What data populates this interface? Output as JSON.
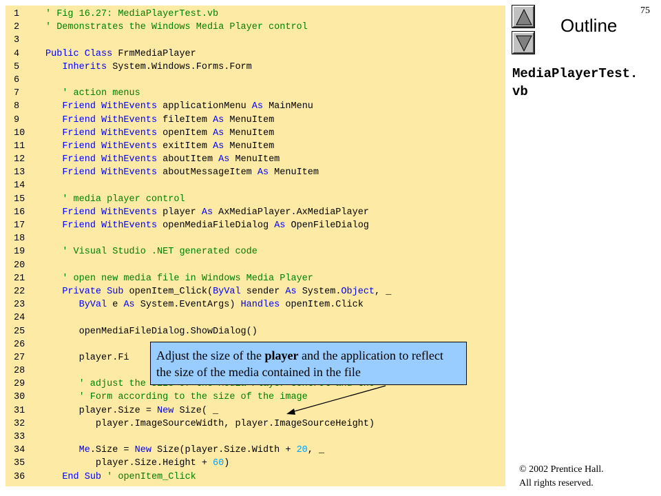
{
  "slide": {
    "page_number": "75",
    "outline_title": "Outline",
    "file_name_line1": "MediaPlayerTest.",
    "file_name_line2": "vb",
    "copyright_line1": "© 2002 Prentice Hall.",
    "copyright_line2": "All rights reserved."
  },
  "callout": {
    "text_before": "Adjust the size of the ",
    "bold_word": "player",
    "text_after": " and the application to reflect the size of the media contained in the file"
  },
  "code": {
    "lines": [
      {
        "n": "1",
        "t": "' Fig 16.27: MediaPlayerTest.vb"
      },
      {
        "n": "2",
        "t": "' Demonstrates the Windows Media Player control"
      },
      {
        "n": "3",
        "t": ""
      },
      {
        "n": "4",
        "t": "Public Class FrmMediaPlayer"
      },
      {
        "n": "5",
        "t": "   Inherits System.Windows.Forms.Form"
      },
      {
        "n": "6",
        "t": ""
      },
      {
        "n": "7",
        "t": "   ' action menus"
      },
      {
        "n": "8",
        "t": "   Friend WithEvents applicationMenu As MainMenu"
      },
      {
        "n": "9",
        "t": "   Friend WithEvents fileItem As MenuItem"
      },
      {
        "n": "10",
        "t": "   Friend WithEvents openItem As MenuItem"
      },
      {
        "n": "11",
        "t": "   Friend WithEvents exitItem As MenuItem"
      },
      {
        "n": "12",
        "t": "   Friend WithEvents aboutItem As MenuItem"
      },
      {
        "n": "13",
        "t": "   Friend WithEvents aboutMessageItem As MenuItem"
      },
      {
        "n": "14",
        "t": ""
      },
      {
        "n": "15",
        "t": "   ' media player control"
      },
      {
        "n": "16",
        "t": "   Friend WithEvents player As AxMediaPlayer.AxMediaPlayer"
      },
      {
        "n": "17",
        "t": "   Friend WithEvents openMediaFileDialog As OpenFileDialog"
      },
      {
        "n": "18",
        "t": ""
      },
      {
        "n": "19",
        "t": "   ' Visual Studio .NET generated code"
      },
      {
        "n": "20",
        "t": ""
      },
      {
        "n": "21",
        "t": "   ' open new media file in Windows Media Player"
      },
      {
        "n": "22",
        "t": "   Private Sub openItem_Click(ByVal sender As System.Object, _"
      },
      {
        "n": "23",
        "t": "      ByVal e As System.EventArgs) Handles openItem.Click"
      },
      {
        "n": "24",
        "t": ""
      },
      {
        "n": "25",
        "t": "      openMediaFileDialog.ShowDialog()"
      },
      {
        "n": "26",
        "t": ""
      },
      {
        "n": "27",
        "t": "      player.Fi"
      },
      {
        "n": "28",
        "t": ""
      },
      {
        "n": "29",
        "t": "      ' adjust the size of the Media Player control and the"
      },
      {
        "n": "30",
        "t": "      ' Form according to the size of the image"
      },
      {
        "n": "31",
        "t": "      player.Size = New Size( _"
      },
      {
        "n": "32",
        "t": "         player.ImageSourceWidth, player.ImageSourceHeight)"
      },
      {
        "n": "33",
        "t": ""
      },
      {
        "n": "34",
        "t": "      Me.Size = New Size(player.Size.Width + 20, _"
      },
      {
        "n": "35",
        "t": "         player.Size.Height + 60)"
      },
      {
        "n": "36",
        "t": "   End Sub ' openItem_Click"
      }
    ],
    "keywords": [
      "Public",
      "Class",
      "Inherits",
      "Friend",
      "WithEvents",
      "As",
      "Private",
      "Sub",
      "ByVal",
      "Handles",
      "New",
      "Me",
      "End",
      "Object"
    ],
    "colors": {
      "keyword": "#0000ff",
      "comment": "#008000",
      "number": "#00a0ff",
      "background": "#fdeaa4"
    }
  },
  "icons": {
    "up": "triangle-up-icon",
    "down": "triangle-down-icon"
  }
}
